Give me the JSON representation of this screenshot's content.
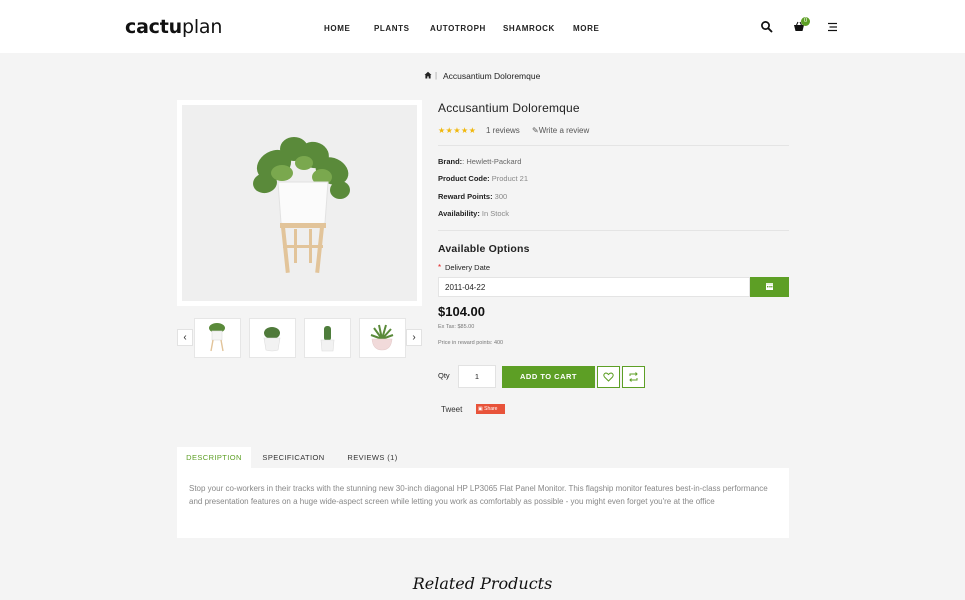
{
  "brand": {
    "logo_a": "cactu",
    "logo_b": "plan"
  },
  "nav": {
    "home": "HOME",
    "plants": "PLANTS",
    "autotroph": "AUTOTROPH",
    "shamrock": "SHAMROCK",
    "more": "MORE"
  },
  "header_icons": {
    "search": "search-icon",
    "cart": "cart-icon",
    "menu": "menu-icon",
    "cart_count": "0"
  },
  "breadcrumb": {
    "separator": "|",
    "current": "Accusantium Doloremque"
  },
  "product": {
    "title": "Accusantium Doloremque",
    "stars": "★★★★★",
    "rating": 5,
    "reviews_label": "1 reviews",
    "write_review_label": "Write a review",
    "brand_label": "Brand:",
    "brand_value": ": Hewlett-Packard",
    "code_label": "Product Code:",
    "code_value": " Product 21",
    "reward_label": "Reward Points:",
    "reward_value": " 300",
    "availability_label": "Availability:",
    "availability_value": " In Stock"
  },
  "options": {
    "title": "Available Options",
    "required_mark": "*",
    "date_label": "Delivery Date",
    "date_value": "2011-04-22"
  },
  "pricing": {
    "price": "$104.00",
    "ex_tax": "Ex Tax: $85.00",
    "reward_price": "Price in reward points: 400"
  },
  "cart": {
    "qty_label": "Qty",
    "qty_value": "1",
    "add_label": "ADD TO CART"
  },
  "social": {
    "tweet": "Tweet",
    "share": "Share"
  },
  "thumb_nav": {
    "prev": "‹",
    "next": "›"
  },
  "tabs": {
    "description": "DESCRIPTION",
    "specification": "SPECIFICATION",
    "reviews": "REVIEWS (1)"
  },
  "description": "Stop your co-workers in their tracks with the stunning new 30-inch diagonal HP LP3065 Flat Panel Monitor. This flagship monitor features best-in-class performance and presentation features on a huge wide-aspect screen while letting you work as comfortably as possible - you might even forget you're at the office",
  "related_title": "Related Products",
  "colors": {
    "accent": "#5d9f25",
    "star": "#f0b70b",
    "background": "#f4f4f4"
  }
}
